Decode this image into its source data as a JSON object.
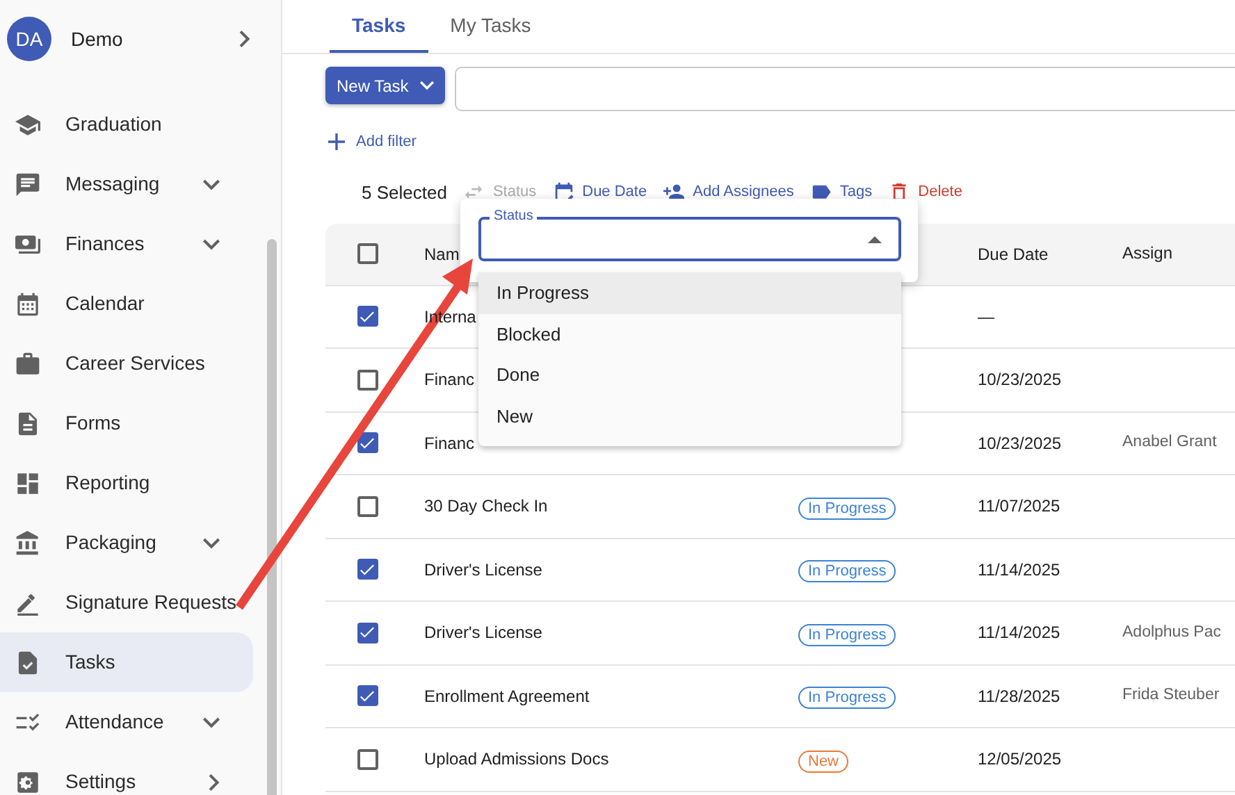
{
  "sidebar": {
    "account": {
      "initials": "DA",
      "name": "Demo"
    },
    "items": [
      {
        "label": "Graduation",
        "kind": "item",
        "selected": false
      },
      {
        "label": "Messaging",
        "kind": "group",
        "selected": false
      },
      {
        "label": "Finances",
        "kind": "group",
        "selected": false
      },
      {
        "label": "Calendar",
        "kind": "item",
        "selected": false
      },
      {
        "label": "Career Services",
        "kind": "item",
        "selected": false
      },
      {
        "label": "Forms",
        "kind": "item",
        "selected": false
      },
      {
        "label": "Reporting",
        "kind": "item",
        "selected": false
      },
      {
        "label": "Packaging",
        "kind": "group",
        "selected": false
      },
      {
        "label": "Signature Requests",
        "kind": "item",
        "selected": false
      },
      {
        "label": "Tasks",
        "kind": "item",
        "selected": true
      },
      {
        "label": "Attendance",
        "kind": "group",
        "selected": false
      },
      {
        "label": "Settings",
        "kind": "link",
        "selected": false
      }
    ]
  },
  "tabs": [
    {
      "label": "Tasks",
      "selected": true
    },
    {
      "label": "My Tasks",
      "selected": false
    }
  ],
  "toolbar": {
    "new_task": "New Task",
    "add_filter": "Add filter"
  },
  "bulk_actions": {
    "count": "5 Selected",
    "actions": [
      {
        "label": "Status",
        "kind": "swap",
        "disabled": true
      },
      {
        "label": "Due Date",
        "kind": "calendar",
        "disabled": false
      },
      {
        "label": "Add Assignees",
        "kind": "person-add",
        "disabled": false
      },
      {
        "label": "Tags",
        "kind": "tag",
        "disabled": false
      },
      {
        "label": "Delete",
        "kind": "trash",
        "disabled": false
      }
    ]
  },
  "table": {
    "header_checked": false,
    "columns": {
      "name": "Nam",
      "due_date": "Due Date",
      "assignee": "Assign"
    },
    "rows": [
      {
        "checked": true,
        "name": "Interna",
        "due_date": "—"
      },
      {
        "checked": false,
        "name": "Financ",
        "due_date": "10/23/2025"
      },
      {
        "checked": true,
        "name": "Financ",
        "due_date": "10/23/2025",
        "assignee": "Anabel Grant"
      },
      {
        "checked": false,
        "name": "30 Day Check In",
        "status": {
          "label": "In Progress",
          "color": "#3b82d6"
        },
        "due_date": "11/07/2025"
      },
      {
        "checked": true,
        "name": "Driver's License",
        "status": {
          "label": "In Progress",
          "color": "#3b82d6"
        },
        "due_date": "11/14/2025"
      },
      {
        "checked": true,
        "name": "Driver's License",
        "status": {
          "label": "In Progress",
          "color": "#3b82d6"
        },
        "due_date": "11/14/2025",
        "assignee": "Adolphus Pac"
      },
      {
        "checked": true,
        "name": "Enrollment Agreement",
        "status": {
          "label": "In Progress",
          "color": "#3b82d6"
        },
        "due_date": "11/28/2025",
        "assignee": "Frida Steuber"
      },
      {
        "checked": false,
        "name": "Upload Admissions Docs",
        "status": {
          "label": "New",
          "color": "#e8793a"
        },
        "due_date": "12/05/2025"
      }
    ]
  },
  "status_dropdown": {
    "label": "Status",
    "options": [
      {
        "label": "In Progress",
        "selected": true
      },
      {
        "label": "Blocked",
        "selected": false
      },
      {
        "label": "Done",
        "selected": false
      },
      {
        "label": "New",
        "selected": false
      }
    ]
  }
}
